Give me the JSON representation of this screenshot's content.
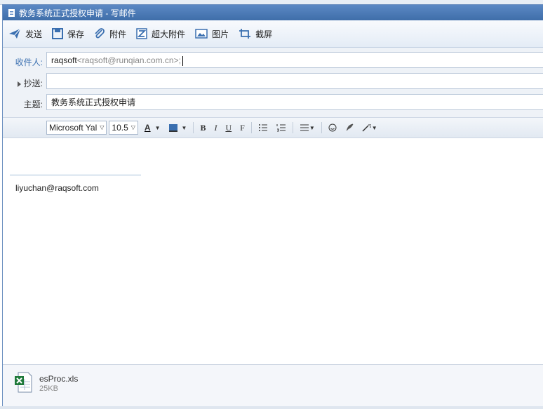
{
  "window": {
    "title": "教务系统正式授权申请 - 写邮件"
  },
  "toolbar": {
    "send": "发送",
    "save": "保存",
    "attach": "附件",
    "large_attach": "超大附件",
    "image": "图片",
    "screenshot": "截屏"
  },
  "fields": {
    "to_label": "收件人:",
    "to_name": "raqsoft",
    "to_address": "<raqsoft@runqian.com.cn>;",
    "cc_label": "抄送:",
    "cc_value": "",
    "subject_label": "主题:",
    "subject_value": "教务系统正式授权申请"
  },
  "format": {
    "font": "Microsoft Yal",
    "size": "10.5",
    "bold": "B",
    "italic": "I",
    "underline": "U",
    "strike": "F"
  },
  "body": {
    "signature": "liyuchan@raqsoft.com"
  },
  "attachment": {
    "name": "esProc.xls",
    "size": "25KB"
  },
  "colors": {
    "titlebar": "#4a7bb8",
    "accent": "#3a6fb0",
    "excel": "#1f7a3a"
  },
  "icons": [
    "send-icon",
    "save-icon",
    "paperclip-icon",
    "large-attach-icon",
    "image-icon",
    "screenshot-icon",
    "excel-icon"
  ]
}
